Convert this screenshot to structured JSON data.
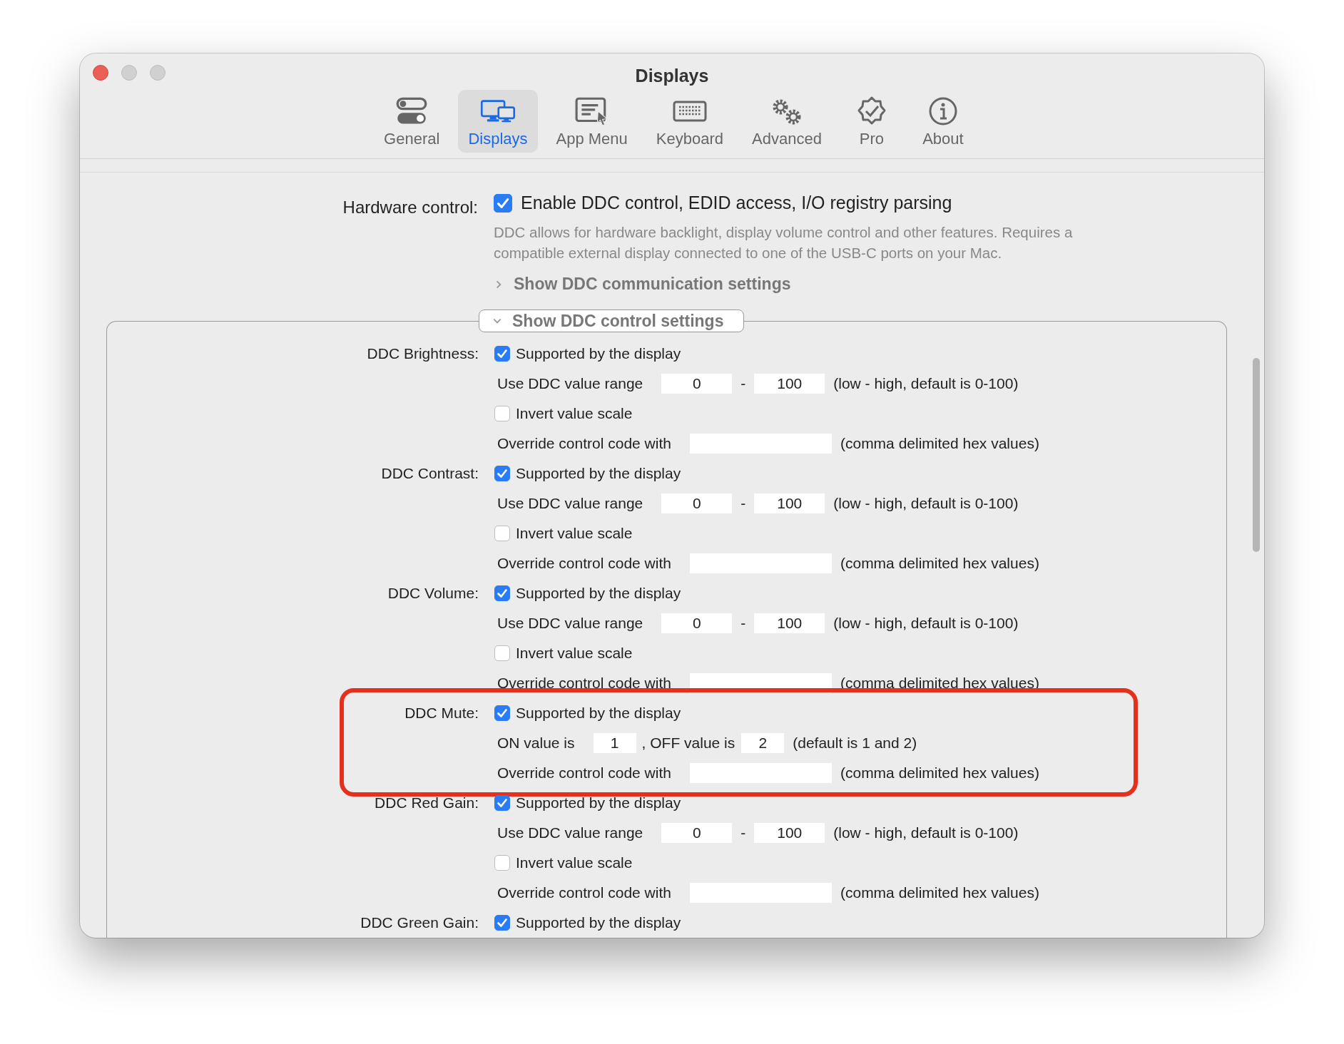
{
  "window": {
    "title": "Displays"
  },
  "tabs": [
    {
      "label": "General",
      "selected": false
    },
    {
      "label": "Displays",
      "selected": true
    },
    {
      "label": "App Menu",
      "selected": false
    },
    {
      "label": "Keyboard",
      "selected": false
    },
    {
      "label": "Advanced",
      "selected": false
    },
    {
      "label": "Pro",
      "selected": false
    },
    {
      "label": "About",
      "selected": false
    }
  ],
  "hardware_control": {
    "label": "Hardware control:",
    "checkbox": {
      "label": "Enable DDC control, EDID access, I/O registry parsing",
      "checked": true
    },
    "description": "DDC allows for hardware backlight, display volume control and other features. Requires a compatible external display connected to one of the USB-C ports on your Mac.",
    "disclosure": {
      "label": "Show DDC communication settings",
      "expanded": false
    }
  },
  "control_group": {
    "disclosure": {
      "label": "Show DDC control settings",
      "expanded": true
    },
    "sections": [
      {
        "label": "DDC Brightness:",
        "highlighted": false,
        "rows": [
          {
            "kind": "checkbox",
            "label": "Supported by the display",
            "checked": true
          },
          {
            "kind": "range",
            "label": "Use DDC value range",
            "low": "0",
            "separator": "-",
            "high": "100",
            "hint": "(low - high, default is 0-100)"
          },
          {
            "kind": "checkbox",
            "label": "Invert value scale",
            "checked": false
          },
          {
            "kind": "override",
            "label": "Override control code with",
            "hint": "(comma delimited hex values)"
          }
        ]
      },
      {
        "label": "DDC Contrast:",
        "highlighted": false,
        "rows": [
          {
            "kind": "checkbox",
            "label": "Supported by the display",
            "checked": true
          },
          {
            "kind": "range",
            "label": "Use DDC value range",
            "low": "0",
            "separator": "-",
            "high": "100",
            "hint": "(low - high, default is 0-100)"
          },
          {
            "kind": "checkbox",
            "label": "Invert value scale",
            "checked": false
          },
          {
            "kind": "override",
            "label": "Override control code with",
            "hint": "(comma delimited hex values)"
          }
        ]
      },
      {
        "label": "DDC Volume:",
        "highlighted": false,
        "rows": [
          {
            "kind": "checkbox",
            "label": "Supported by the display",
            "checked": true
          },
          {
            "kind": "range",
            "label": "Use DDC value range",
            "low": "0",
            "separator": "-",
            "high": "100",
            "hint": "(low - high, default is 0-100)"
          },
          {
            "kind": "checkbox",
            "label": "Invert value scale",
            "checked": false
          },
          {
            "kind": "override",
            "label": "Override control code with",
            "hint": "(comma delimited hex values)"
          }
        ]
      },
      {
        "label": "DDC Mute:",
        "highlighted": true,
        "rows": [
          {
            "kind": "checkbox",
            "label": "Supported by the display",
            "checked": true
          },
          {
            "kind": "onoff",
            "on_label": "ON value is",
            "on_value": "1",
            "off_label": ", OFF value is",
            "off_value": "2",
            "hint": "(default is 1 and 2)"
          },
          {
            "kind": "override",
            "label": "Override control code with",
            "hint": "(comma delimited hex values)"
          }
        ]
      },
      {
        "label": "DDC Red Gain:",
        "highlighted": false,
        "rows": [
          {
            "kind": "checkbox",
            "label": "Supported by the display",
            "checked": true
          },
          {
            "kind": "range",
            "label": "Use DDC value range",
            "low": "0",
            "separator": "-",
            "high": "100",
            "hint": "(low - high, default is 0-100)"
          },
          {
            "kind": "checkbox",
            "label": "Invert value scale",
            "checked": false
          },
          {
            "kind": "override",
            "label": "Override control code with",
            "hint": "(comma delimited hex values)"
          }
        ]
      },
      {
        "label": "DDC Green Gain:",
        "highlighted": false,
        "rows": [
          {
            "kind": "checkbox",
            "label": "Supported by the display",
            "checked": true
          }
        ]
      }
    ]
  }
}
